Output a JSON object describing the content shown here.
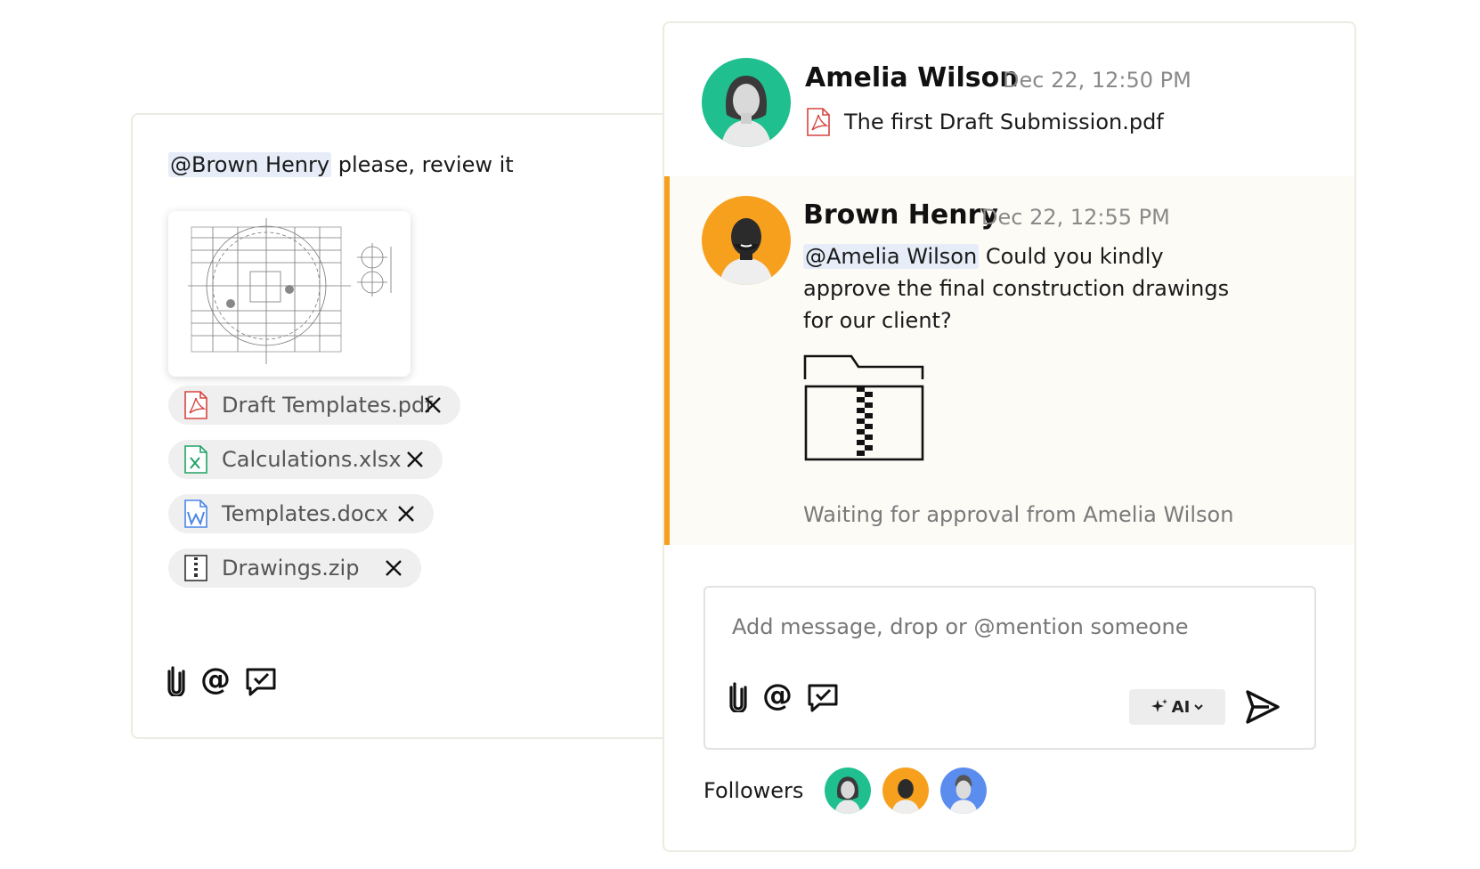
{
  "composer": {
    "mention": "@Brown Henry",
    "message_rest": "please, review it",
    "attachments": [
      {
        "name": "Draft Templates.pdf",
        "type": "pdf-file-icon",
        "color": "#d64541"
      },
      {
        "name": "Calculations.xlsx",
        "type": "excel-file-icon",
        "color": "#21a366"
      },
      {
        "name": "Templates.docx",
        "type": "word-file-icon",
        "color": "#4a86e8"
      },
      {
        "name": "Drawings.zip",
        "type": "zip-file-icon",
        "color": "#333333"
      }
    ],
    "toolbar": [
      "paperclip-icon",
      "at-mention-icon",
      "approval-request-icon"
    ]
  },
  "thread": {
    "first_message": {
      "author": "Amelia Wilson",
      "timestamp": "Dec 22, 12:50 PM",
      "attachment": "The first Draft Submission.pdf",
      "avatar_bg": "#1fbf8f"
    },
    "reply": {
      "author": "Brown Henry",
      "timestamp": "Dec 22, 12:55 PM",
      "mention": "@Amelia Wilson",
      "text": "Could you kindly approve the final construction drawings for our client?",
      "attachment_icon": "zip-folder-icon",
      "status": "Waiting for approval from Amelia Wilson",
      "avatar_bg": "#f7a01e",
      "accent": "#f7a01e"
    },
    "input": {
      "placeholder": "Add message, drop or @mention someone",
      "ai_label": "AI"
    },
    "followers_label": "Followers",
    "followers": [
      {
        "avatar_bg": "#1fbf8f"
      },
      {
        "avatar_bg": "#f7a01e"
      },
      {
        "avatar_bg": "#5b8def"
      }
    ]
  }
}
